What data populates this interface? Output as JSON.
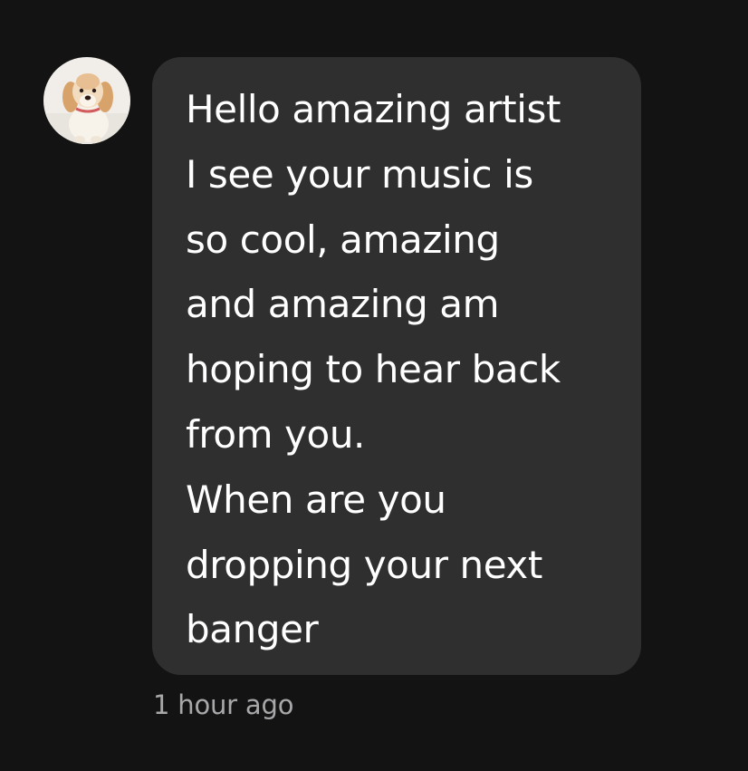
{
  "message": {
    "avatar_icon": "puppy-avatar",
    "lines": [
      "Hello amazing artist",
      "I see your music is",
      "so cool, amazing",
      "and amazing am",
      "hoping to hear back",
      "from you.",
      "When are you",
      "dropping your next",
      "banger"
    ],
    "timestamp": "1 hour ago"
  },
  "colors": {
    "background": "#131314",
    "bubble": "#2f2f30",
    "text": "#ffffff",
    "timestamp": "#a8a8aa"
  }
}
